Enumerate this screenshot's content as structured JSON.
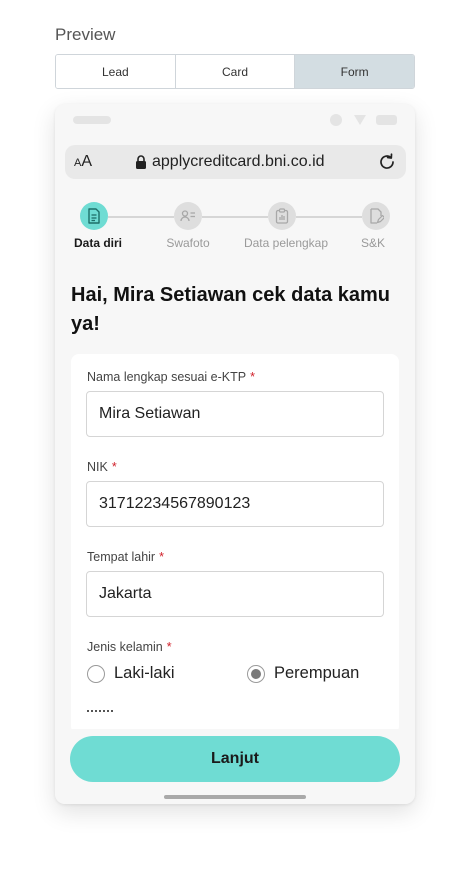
{
  "preview": {
    "title": "Preview"
  },
  "tabs": [
    {
      "label": "Lead",
      "active": false
    },
    {
      "label": "Card",
      "active": false
    },
    {
      "label": "Form",
      "active": true
    }
  ],
  "browser": {
    "aa_small": "A",
    "aa_large": "A",
    "url": "applycreditcard.bni.co.id",
    "lock_icon": "lock-icon",
    "reload_icon": "reload-icon"
  },
  "steps": [
    {
      "label": "Data diri",
      "icon": "document-icon",
      "active": true
    },
    {
      "label": "Swafoto",
      "icon": "id-card-icon",
      "active": false
    },
    {
      "label": "Data pelengkap",
      "icon": "clipboard-icon",
      "active": false
    },
    {
      "label": "S&K",
      "icon": "document-sign-icon",
      "active": false
    }
  ],
  "greeting": "Hai, Mira Setiawan cek data kamu ya!",
  "form": {
    "required_mark": "*",
    "full_name": {
      "label": "Nama lengkap sesuai e-KTP",
      "value": "Mira Setiawan"
    },
    "nik": {
      "label": "NIK",
      "value": "31712234567890123"
    },
    "birthplace": {
      "label": "Tempat lahir",
      "value": "Jakarta"
    },
    "gender": {
      "label": "Jenis kelamin",
      "options": [
        {
          "label": "Laki-laki",
          "selected": false
        },
        {
          "label": "Perempuan",
          "selected": true
        }
      ]
    }
  },
  "cta": {
    "label": "Lanjut"
  },
  "colors": {
    "accent": "#6fdcd3",
    "active_tab": "#d3dde2",
    "required": "#d0202a"
  }
}
